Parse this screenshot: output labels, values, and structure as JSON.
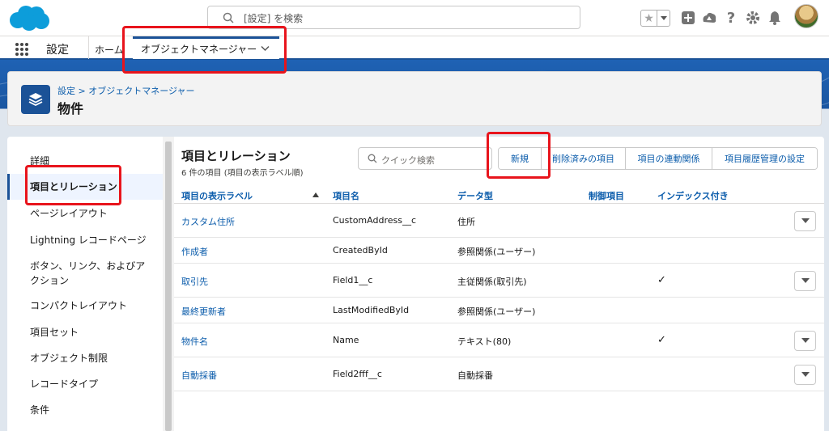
{
  "global_header": {
    "search_placeholder": "[設定] を検索"
  },
  "nav": {
    "app_name": "設定",
    "home_label": "ホーム",
    "active_tab_label": "オブジェクトマネージャー"
  },
  "setup_header": {
    "breadcrumb": "設定 > オブジェクトマネージャー",
    "title": "物件"
  },
  "sidebar": {
    "items": [
      {
        "label": "詳細"
      },
      {
        "label": "項目とリレーション"
      },
      {
        "label": "ページレイアウト"
      },
      {
        "label": "Lightning レコードページ"
      },
      {
        "label": "ボタン、リンク、およびア"
      },
      {
        "label": "クション"
      },
      {
        "label": "コンパクトレイアウト"
      },
      {
        "label": "項目セット"
      },
      {
        "label": "オブジェクト制限"
      },
      {
        "label": "レコードタイプ"
      },
      {
        "label": "条件"
      }
    ]
  },
  "main": {
    "title": "項目とリレーション",
    "subtitle": "6 件の項目 (項目の表示ラベル順)",
    "quick_find_placeholder": "クイック検索",
    "buttons": {
      "new": "新規",
      "deleted": "削除済みの項目",
      "dependencies": "項目の連動関係",
      "history": "項目履歴管理の設定"
    },
    "columns": {
      "label": "項目の表示ラベル",
      "api": "項目名",
      "type": "データ型",
      "controlling": "制御項目",
      "indexed": "インデックス付き"
    },
    "rows": [
      {
        "label": "カスタム住所",
        "api": "CustomAddress__c",
        "type": "住所",
        "indexed": ""
      },
      {
        "label": "作成者",
        "api": "CreatedById",
        "type": "参照関係(ユーザー)",
        "indexed": ""
      },
      {
        "label": "取引先",
        "api": "Field1__c",
        "type": "主従関係(取引先)",
        "indexed": "✓"
      },
      {
        "label": "最終更新者",
        "api": "LastModifiedById",
        "type": "参照関係(ユーザー)",
        "indexed": ""
      },
      {
        "label": "物件名",
        "api": "Name",
        "type": "テキスト(80)",
        "indexed": "✓"
      },
      {
        "label": "自動採番",
        "api": "Field2fff__c",
        "type": "自動採番",
        "indexed": ""
      }
    ]
  }
}
